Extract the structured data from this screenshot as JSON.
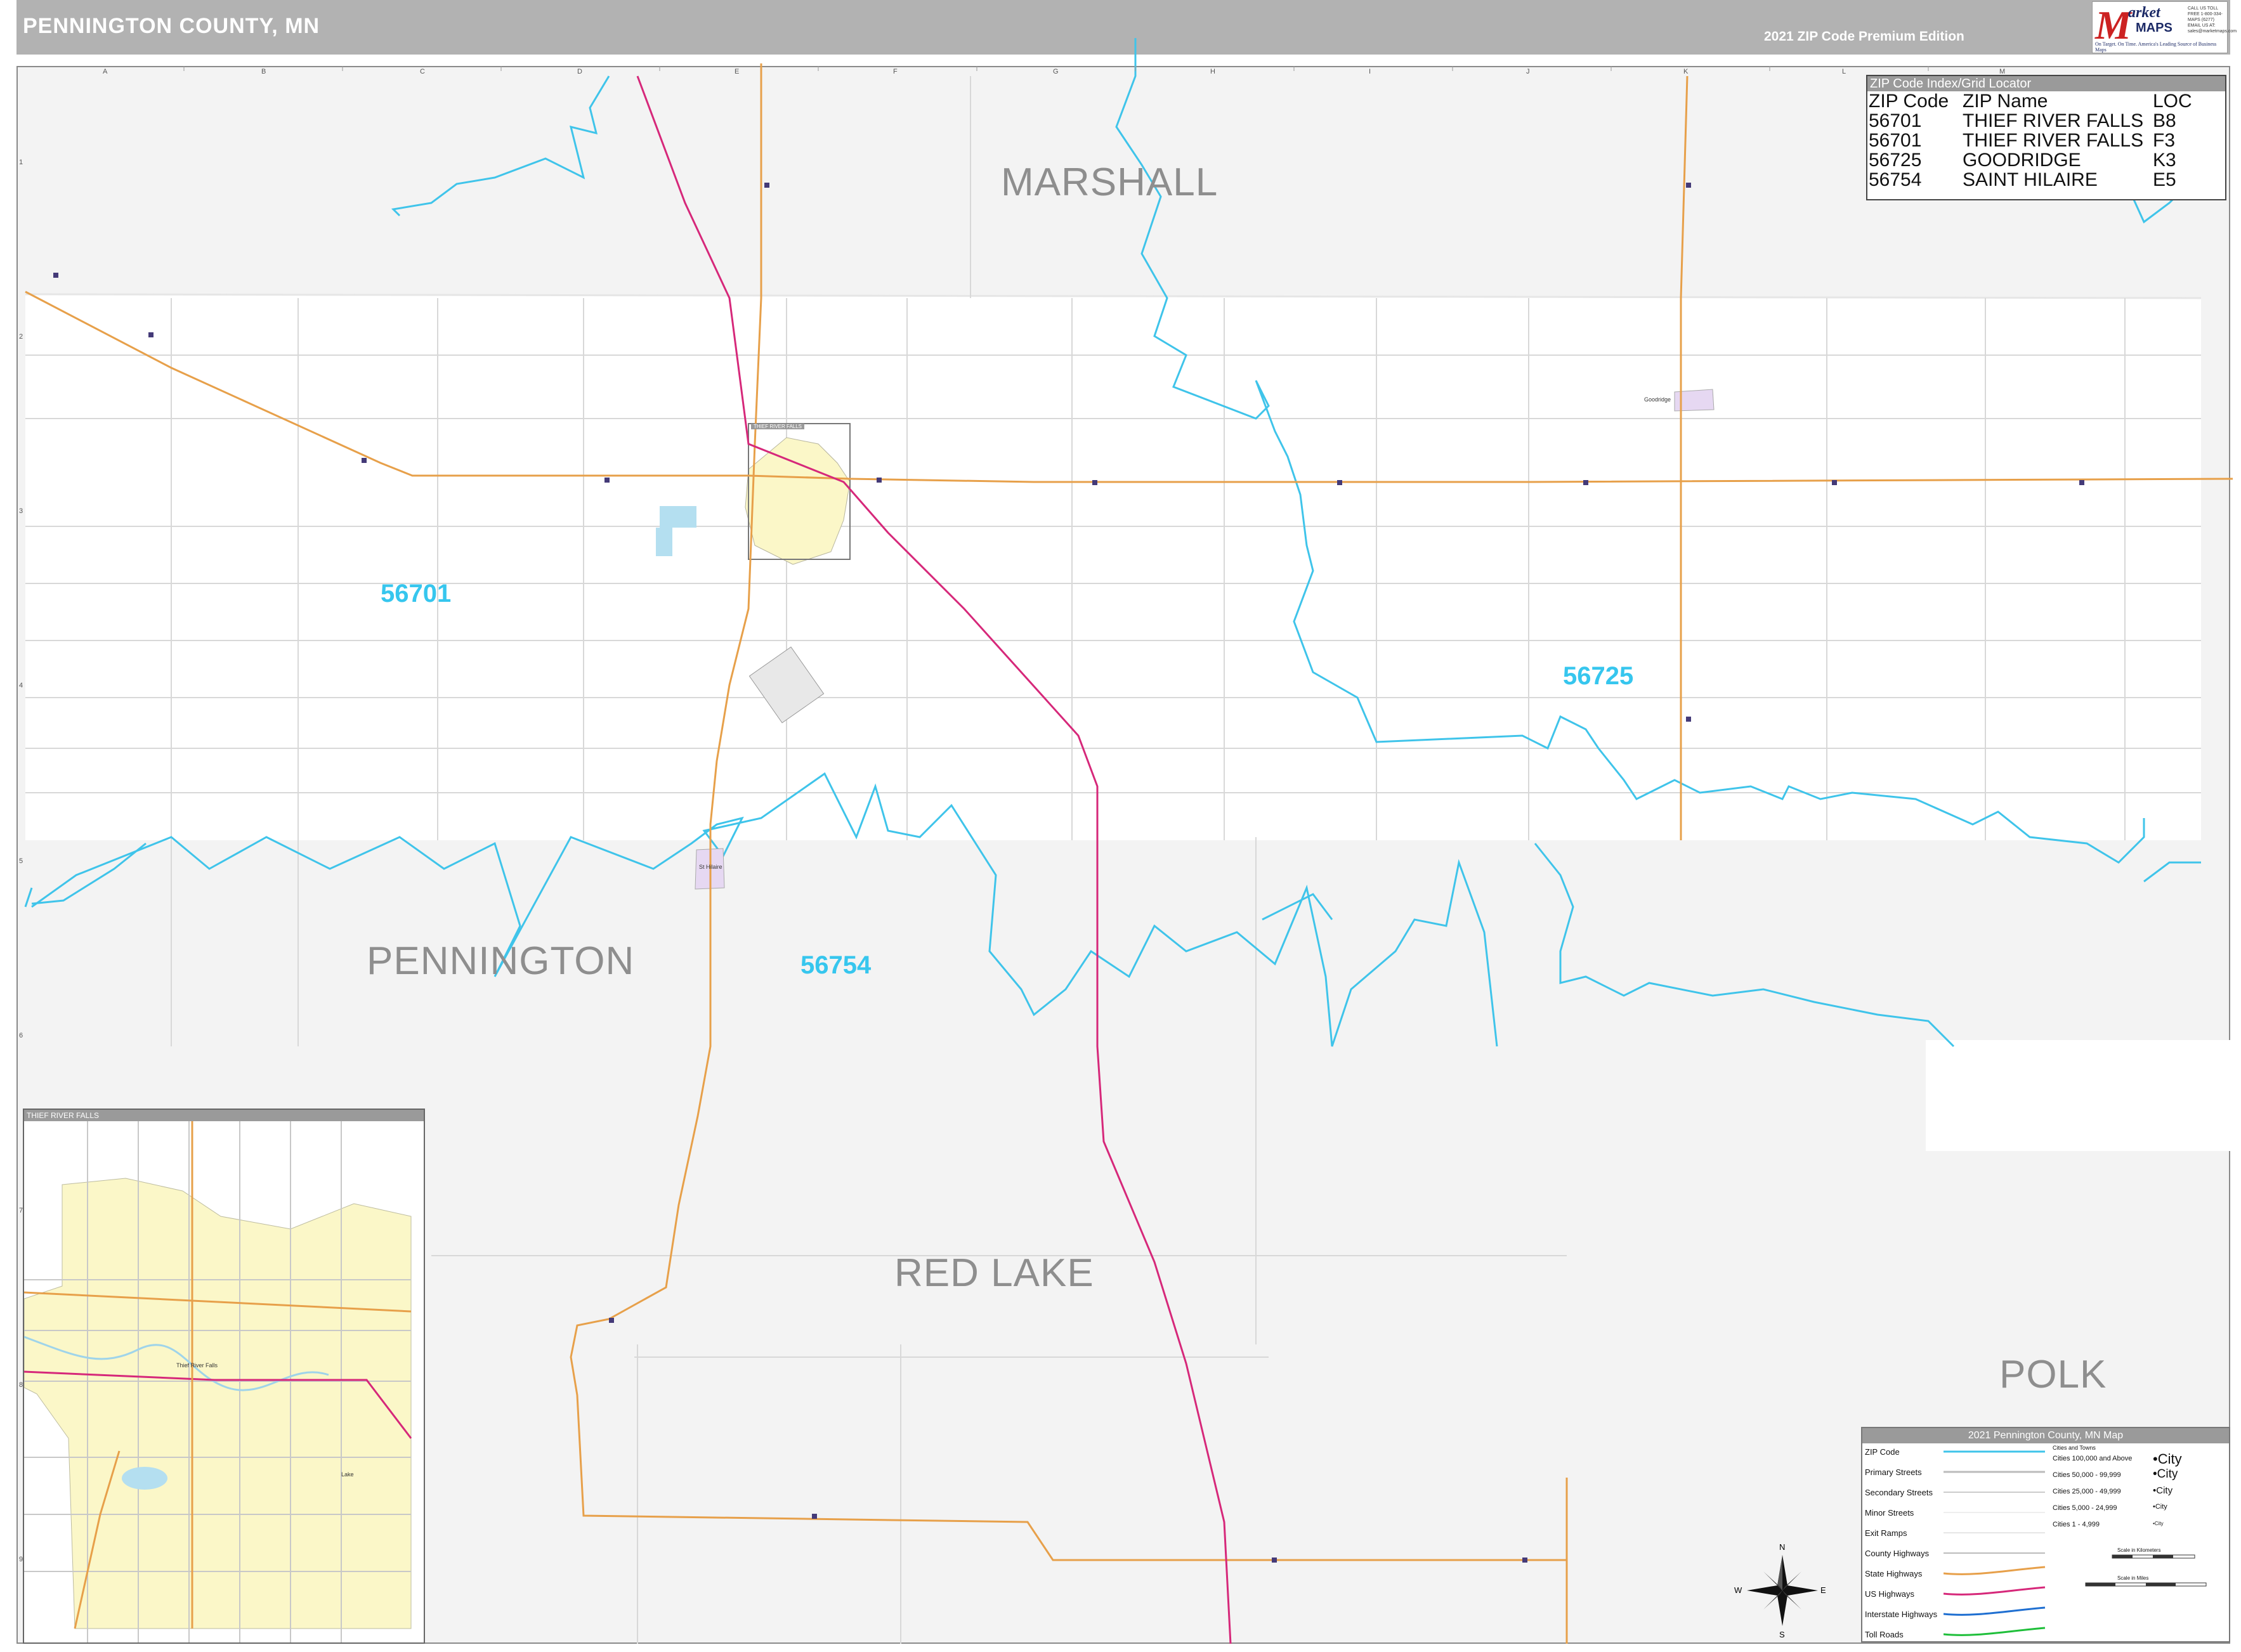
{
  "title": "PENNINGTON COUNTY, MN",
  "edition": "2021 ZIP Code Premium Edition",
  "logo": {
    "letter": "M",
    "market": "arket",
    "maps": "MAPS",
    "tagline": "On Target. On Time. America's Leading Source of Business Maps",
    "contact": "CALL US TOLL FREE 1-800-334-MAPS (6277) EMAIL US AT: sales@marketmaps.com"
  },
  "grid": {
    "columns": [
      "A",
      "B",
      "C",
      "D",
      "E",
      "F",
      "G",
      "H",
      "I",
      "J",
      "K",
      "L",
      "M"
    ],
    "rows": [
      "1",
      "2",
      "3",
      "4",
      "5",
      "6",
      "7",
      "8",
      "9"
    ]
  },
  "county_labels": {
    "marshall": "MARSHALL",
    "pennington": "PENNINGTON",
    "red_lake": "RED LAKE",
    "polk": "POLK"
  },
  "zip_labels": {
    "z56701": "56701",
    "z56725": "56725",
    "z56754": "56754"
  },
  "zip_index": {
    "header": "ZIP Code Index/Grid Locator",
    "columns": [
      "ZIP Code",
      "ZIP Name",
      "LOC"
    ],
    "rows": [
      [
        "56701",
        "THIEF RIVER FALLS",
        "B8"
      ],
      [
        "56701",
        "THIEF RIVER FALLS",
        "F3"
      ],
      [
        "56725",
        "GOODRIDGE",
        "K3"
      ],
      [
        "56754",
        "SAINT HILAIRE",
        "E5"
      ]
    ]
  },
  "inset": {
    "title": "THIEF RIVER FALLS",
    "box_label": "THIEF RIVER FALLS",
    "street_label": "Thief River Falls",
    "lake_label": "Lake"
  },
  "town_labels": {
    "goodridge": "Goodridge",
    "st_hilaire": "St Hilaire"
  },
  "legend": {
    "title": "2021 Pennington County, MN Map",
    "items": [
      "ZIP Code",
      "Primary Streets",
      "Secondary Streets",
      "Minor Streets",
      "Exit Ramps",
      "County Highways",
      "State Highways",
      "US Highways",
      "Interstate Highways",
      "Toll Roads"
    ],
    "cities_header": "Cities and Towns",
    "cities": [
      {
        "range": "Cities 100,000 and Above",
        "sample": "•City"
      },
      {
        "range": "Cities 50,000 - 99,999",
        "sample": "•City"
      },
      {
        "range": "Cities 25,000 - 49,999",
        "sample": "•City"
      },
      {
        "range": "Cities 5,000 - 24,999",
        "sample": "•City"
      },
      {
        "range": "Cities 1 - 4,999",
        "sample": "•City"
      }
    ],
    "scale_km": "Scale in Kilometers",
    "scale_mi": "Scale in Miles"
  },
  "compass": {
    "n": "N",
    "s": "S",
    "e": "E",
    "w": "W"
  },
  "colors": {
    "zip_boundary": "#3fc4ea",
    "us_highway": "#d6287a",
    "state_highway": "#e7a04a",
    "county_fill": "#ffffff",
    "outside_fill": "#f3f3f3",
    "city_fill": "#fbf7c8"
  }
}
